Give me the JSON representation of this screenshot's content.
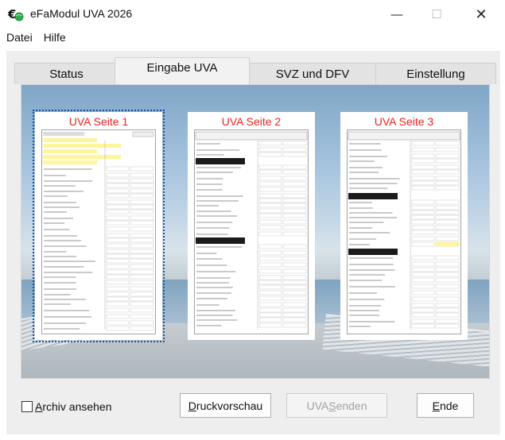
{
  "window": {
    "title": "eFaModul UVA 2026",
    "controls": {
      "minimize": "—",
      "maximize": "☐",
      "close": "✕"
    }
  },
  "menu": {
    "items": [
      "Datei",
      "Hilfe"
    ]
  },
  "tabs": [
    {
      "label": "Status",
      "active": false
    },
    {
      "label": "Eingabe UVA",
      "active": true
    },
    {
      "label": "SVZ und DFV",
      "active": false
    },
    {
      "label": "Einstellung",
      "active": false
    }
  ],
  "pages": [
    {
      "title": "UVA Seite 1",
      "selected": true
    },
    {
      "title": "UVA Seite 2",
      "selected": false
    },
    {
      "title": "UVA Seite 3",
      "selected": false
    }
  ],
  "bottom": {
    "archive": {
      "underline": "A",
      "rest": "rchiv ansehen",
      "checked": false
    },
    "preview": {
      "underline": "D",
      "rest": "ruckvorschau"
    },
    "send": {
      "prefix": "UVA ",
      "underline": "S",
      "rest": "enden",
      "enabled": false
    },
    "end": {
      "underline": "E",
      "rest": "nde"
    }
  },
  "colors": {
    "page_title": "#ee2222",
    "form_header": "#1b1b1b",
    "form_highlight": "#fff59a",
    "selection": "#1d4f9b",
    "disabled_text": "#a2a2a2"
  },
  "icons": {
    "app": "euro-globe-icon"
  }
}
